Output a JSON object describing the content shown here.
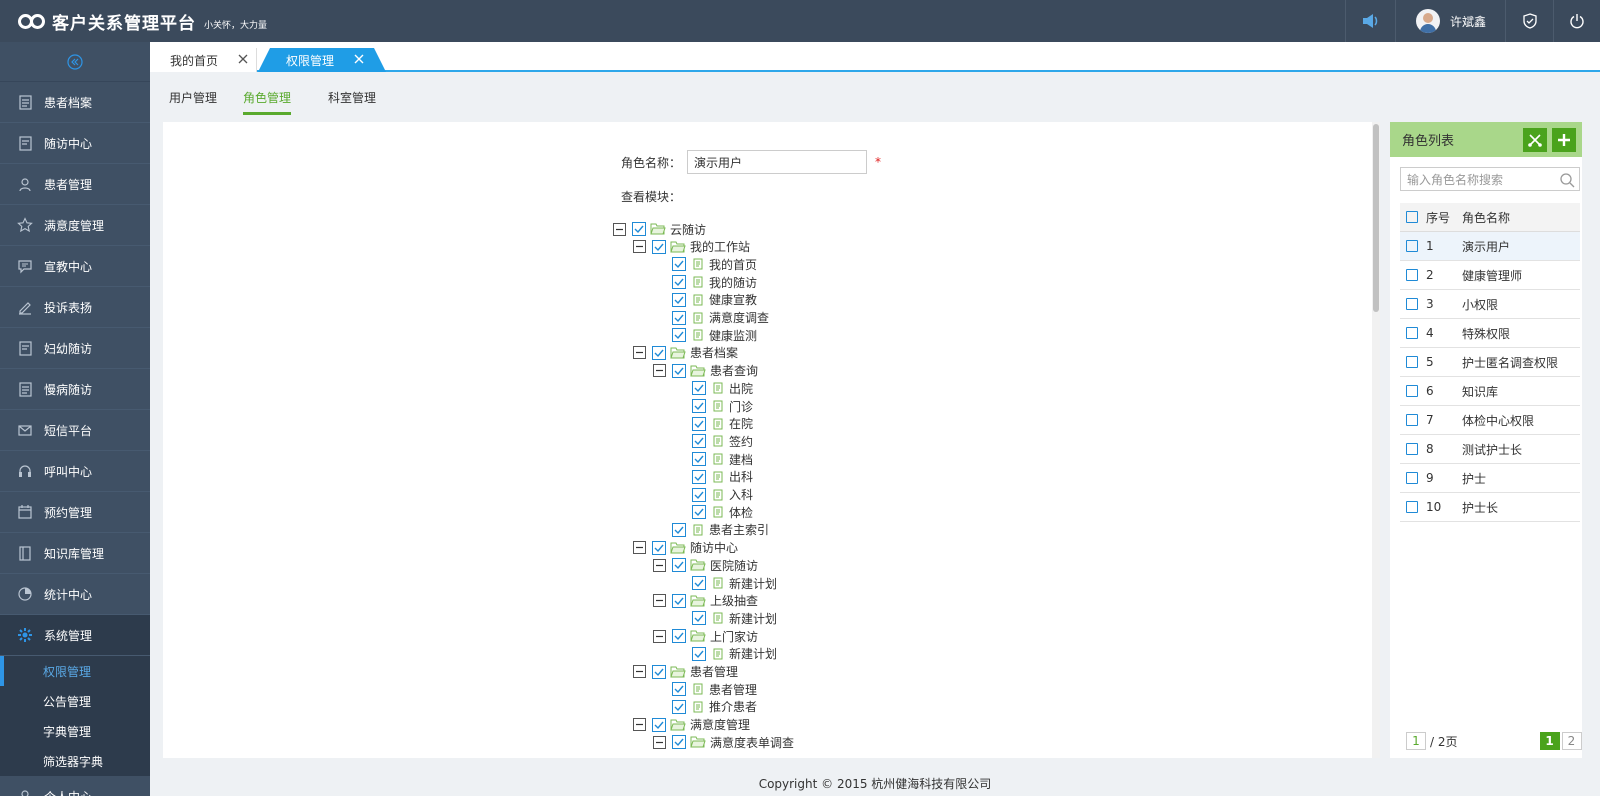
{
  "app": {
    "title": "客户关系管理平台",
    "slogan": "小关怀，大力量",
    "user_name": "许斌鑫"
  },
  "colors": {
    "topbar": "#3b4a5c",
    "sidebar": "#3f5064",
    "accent_blue": "#1f9de6",
    "accent_green": "#4aa31c"
  },
  "sidebar": {
    "items": [
      {
        "label": "患者档案",
        "icon": "document-icon"
      },
      {
        "label": "随访中心",
        "icon": "note-icon"
      },
      {
        "label": "患者管理",
        "icon": "user-icon"
      },
      {
        "label": "满意度管理",
        "icon": "star-icon"
      },
      {
        "label": "宣教中心",
        "icon": "chat-icon"
      },
      {
        "label": "投诉表扬",
        "icon": "pen-icon"
      },
      {
        "label": "妇幼随访",
        "icon": "note-icon"
      },
      {
        "label": "慢病随访",
        "icon": "document-icon"
      },
      {
        "label": "短信平台",
        "icon": "mail-icon"
      },
      {
        "label": "呼叫中心",
        "icon": "headset-icon"
      },
      {
        "label": "预约管理",
        "icon": "calendar-icon"
      },
      {
        "label": "知识库管理",
        "icon": "book-icon"
      },
      {
        "label": "统计中心",
        "icon": "pie-icon"
      },
      {
        "label": "系统管理",
        "icon": "gear-icon"
      }
    ],
    "sub_items": [
      {
        "label": "权限管理"
      },
      {
        "label": "公告管理"
      },
      {
        "label": "字典管理"
      },
      {
        "label": "筛选器字典"
      }
    ],
    "last_item": "个人中心"
  },
  "tabs": [
    {
      "label": "我的首页"
    },
    {
      "label": "权限管理"
    }
  ],
  "subtabs": [
    {
      "label": "用户管理"
    },
    {
      "label": "角色管理"
    },
    {
      "label": "科室管理"
    }
  ],
  "form": {
    "role_name_label": "角色名称：",
    "role_name_value": "演示用户",
    "required_mark": "*",
    "module_label": "查看模块："
  },
  "tree": [
    {
      "label": "云随访",
      "depth": 0,
      "folder": true
    },
    {
      "label": "我的工作站",
      "depth": 1,
      "folder": true
    },
    {
      "label": "我的首页",
      "depth": 2,
      "folder": false
    },
    {
      "label": "我的随访",
      "depth": 2,
      "folder": false
    },
    {
      "label": "健康宣教",
      "depth": 2,
      "folder": false
    },
    {
      "label": "满意度调查",
      "depth": 2,
      "folder": false
    },
    {
      "label": "健康监测",
      "depth": 2,
      "folder": false
    },
    {
      "label": "患者档案",
      "depth": 1,
      "folder": true
    },
    {
      "label": "患者查询",
      "depth": 2,
      "folder": true
    },
    {
      "label": "出院",
      "depth": 3,
      "folder": false
    },
    {
      "label": "门诊",
      "depth": 3,
      "folder": false
    },
    {
      "label": "在院",
      "depth": 3,
      "folder": false
    },
    {
      "label": "签约",
      "depth": 3,
      "folder": false
    },
    {
      "label": "建档",
      "depth": 3,
      "folder": false
    },
    {
      "label": "出科",
      "depth": 3,
      "folder": false
    },
    {
      "label": "入科",
      "depth": 3,
      "folder": false
    },
    {
      "label": "体检",
      "depth": 3,
      "folder": false
    },
    {
      "label": "患者主索引",
      "depth": 2,
      "folder": false
    },
    {
      "label": "随访中心",
      "depth": 1,
      "folder": true
    },
    {
      "label": "医院随访",
      "depth": 2,
      "folder": true
    },
    {
      "label": "新建计划",
      "depth": 3,
      "folder": false
    },
    {
      "label": "上级抽查",
      "depth": 2,
      "folder": true
    },
    {
      "label": "新建计划",
      "depth": 3,
      "folder": false
    },
    {
      "label": "上门家访",
      "depth": 2,
      "folder": true
    },
    {
      "label": "新建计划",
      "depth": 3,
      "folder": false
    },
    {
      "label": "患者管理",
      "depth": 1,
      "folder": true
    },
    {
      "label": "患者管理",
      "depth": 2,
      "folder": false
    },
    {
      "label": "推介患者",
      "depth": 2,
      "folder": false
    },
    {
      "label": "满意度管理",
      "depth": 1,
      "folder": true
    },
    {
      "label": "满意度表单调查",
      "depth": 2,
      "folder": true
    }
  ],
  "role_panel": {
    "title": "角色列表",
    "search_placeholder": "输入角色名称搜索",
    "col_index": "序号",
    "col_name": "角色名称",
    "rows": [
      {
        "index": "1",
        "name": "演示用户"
      },
      {
        "index": "2",
        "name": "健康管理师"
      },
      {
        "index": "3",
        "name": "小权限"
      },
      {
        "index": "4",
        "name": "特殊权限"
      },
      {
        "index": "5",
        "name": "护士匿名调查权限"
      },
      {
        "index": "6",
        "name": "知识库"
      },
      {
        "index": "7",
        "name": "体检中心权限"
      },
      {
        "index": "8",
        "name": "测试护士长"
      },
      {
        "index": "9",
        "name": "护士"
      },
      {
        "index": "10",
        "name": "护士长"
      }
    ],
    "pager": {
      "input_value": "1",
      "total_text": "/ 2页",
      "pages": [
        "1",
        "2"
      ]
    }
  },
  "footer": "Copyright © 2015 杭州健海科技有限公司"
}
